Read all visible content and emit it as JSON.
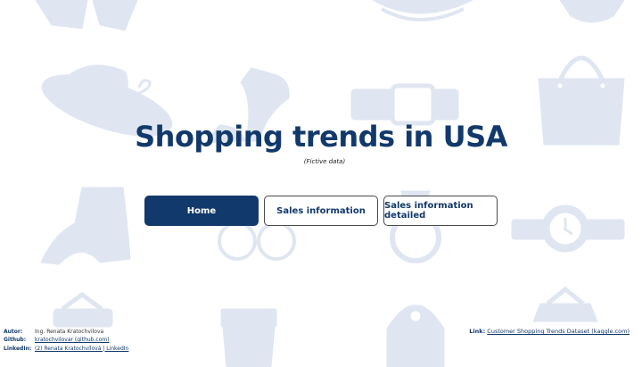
{
  "header": {
    "title": "Shopping trends in USA",
    "subtitle": "(Fictive data)"
  },
  "nav": {
    "home": "Home",
    "sales": "Sales information",
    "sales_detailed": "Sales information detailed",
    "active": "Home"
  },
  "footer": {
    "author_label": "Autor:",
    "author_value": "Ing. Renata Kratochvilova",
    "github_label": "Github:",
    "github_value": "kratochvilovar (github.com)",
    "linkedin_label": "LinkedIn:",
    "linkedin_value": "(2) Renata Kratochvílová | LinkedIn",
    "link_label": "Link:",
    "link_value": "Customer Shopping Trends Dataset (kaggle.com)"
  },
  "colors": {
    "accent": "#12396b",
    "background_icons": "#dfe6f1",
    "background": "#ffffff"
  },
  "background_icons": [
    "jacket-icon",
    "bowl-icon",
    "swimsuit-icon",
    "hat-icon",
    "high-heel-icon",
    "belt-icon",
    "handbag-icon",
    "boot-icon",
    "glasses-icon",
    "ring-icon",
    "wristwatch-icon",
    "hanger-icon",
    "pants-icon",
    "coat-icon",
    "hanger-icon"
  ]
}
